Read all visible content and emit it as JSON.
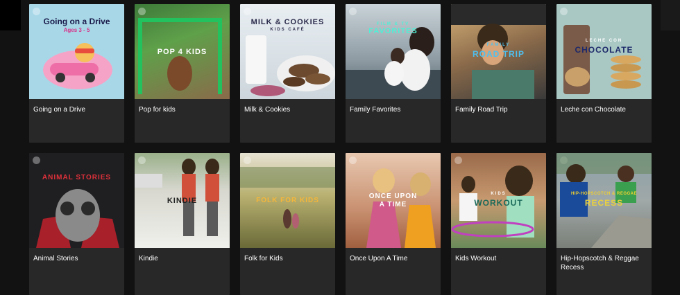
{
  "row1": [
    {
      "title": "Going on a Drive",
      "art_title": "Going on a Drive",
      "art_sub": "Ages 3 - 5"
    },
    {
      "title": "Pop for kids",
      "art_title": "POP 4 KIDS"
    },
    {
      "title": "Milk & Cookies",
      "art_title": "MILK & COOKIES",
      "art_sub": "KIDS CAFÉ"
    },
    {
      "title": "Family Favorites",
      "art_top": "FILM & TV",
      "art_title": "FAVORITES"
    },
    {
      "title": "Family Road Trip",
      "art_top": "FAMILY",
      "art_title": "ROAD TRIP"
    },
    {
      "title": "Leche con Chocolate",
      "art_top": "LECHE CON",
      "art_title": "CHOCOLATE"
    }
  ],
  "row2": [
    {
      "title": "Animal Stories",
      "art_title": "ANIMAL STORIES"
    },
    {
      "title": "Kindie",
      "art_title": "KINDIE"
    },
    {
      "title": "Folk for Kids",
      "art_title": "FOLK FOR KIDS"
    },
    {
      "title": "Once Upon A Time",
      "art_title": "ONCE UPON",
      "art_title2": "A TIME"
    },
    {
      "title": "Kids Workout",
      "art_top": "KIDS",
      "art_title": "WORKOUT"
    },
    {
      "title": "Hip-Hopscotch & Reggae Recess",
      "art_top": "HIP-HOPSCOTCH & REGGAE",
      "art_title": "RECESS"
    }
  ]
}
